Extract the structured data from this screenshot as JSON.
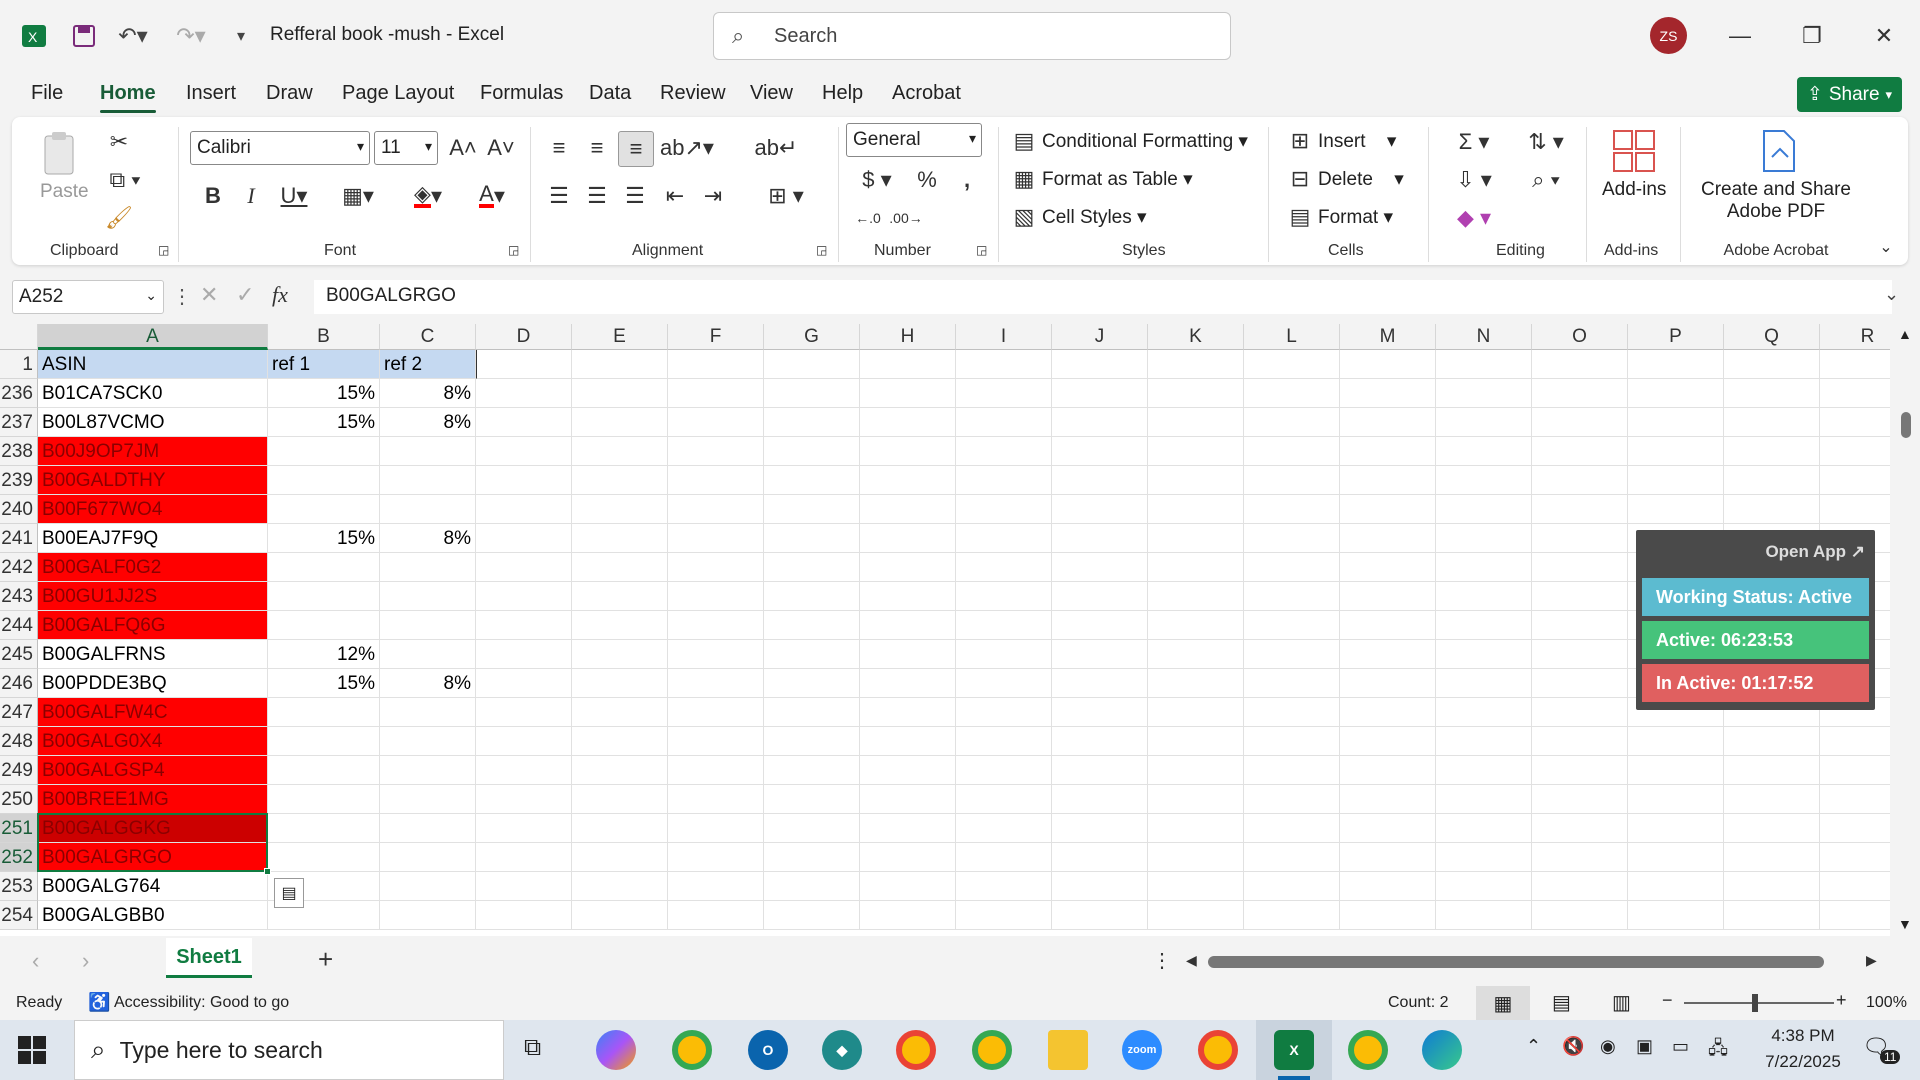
{
  "app": {
    "title": "Refferal book -mush  -  Excel",
    "avatar_initials": "ZS"
  },
  "search": {
    "placeholder": "Search"
  },
  "tabs": [
    "File",
    "Home",
    "Insert",
    "Draw",
    "Page Layout",
    "Formulas",
    "Data",
    "Review",
    "View",
    "Help",
    "Acrobat"
  ],
  "active_tab": "Home",
  "share_label": "Share",
  "ribbon": {
    "clipboard": {
      "label": "Clipboard",
      "paste": "Paste"
    },
    "font": {
      "label": "Font",
      "name": "Calibri",
      "size": "11"
    },
    "alignment": {
      "label": "Alignment"
    },
    "number": {
      "label": "Number",
      "format": "General"
    },
    "styles": {
      "label": "Styles",
      "conditional": "Conditional Formatting",
      "format_table": "Format as Table",
      "cell_styles": "Cell Styles"
    },
    "cells": {
      "label": "Cells",
      "insert": "Insert",
      "delete": "Delete",
      "format": "Format"
    },
    "editing": {
      "label": "Editing"
    },
    "addins": {
      "label": "Add-ins",
      "button": "Add-ins"
    },
    "acrobat": {
      "label": "Adobe Acrobat",
      "button_line1": "Create and Share",
      "button_line2": "Adobe PDF"
    }
  },
  "formula_bar": {
    "name_box": "A252",
    "fx": "fx",
    "value": "B00GALGRGO"
  },
  "columns": [
    "A",
    "B",
    "C",
    "D",
    "E",
    "F",
    "G",
    "H",
    "I",
    "J",
    "K",
    "L",
    "M",
    "N",
    "O",
    "P",
    "Q",
    "R"
  ],
  "rows": [
    {
      "num": "1",
      "a": "ASIN",
      "b": "ref 1",
      "c": "ref 2",
      "style": "header"
    },
    {
      "num": "236",
      "a": "B01CA7SCK0",
      "b": "15%",
      "c": "8%",
      "style": "normal"
    },
    {
      "num": "237",
      "a": "B00L87VCMO",
      "b": "15%",
      "c": "8%",
      "style": "normal"
    },
    {
      "num": "238",
      "a": "B00J9OP7JM",
      "b": "",
      "c": "",
      "style": "red"
    },
    {
      "num": "239",
      "a": "B00GALDTHY",
      "b": "",
      "c": "",
      "style": "red"
    },
    {
      "num": "240",
      "a": "B00F677WO4",
      "b": "",
      "c": "",
      "style": "red"
    },
    {
      "num": "241",
      "a": "B00EAJ7F9Q",
      "b": "15%",
      "c": "8%",
      "style": "normal"
    },
    {
      "num": "242",
      "a": "B00GALF0G2",
      "b": "",
      "c": "",
      "style": "red"
    },
    {
      "num": "243",
      "a": "B00GU1JJ2S",
      "b": "",
      "c": "",
      "style": "red"
    },
    {
      "num": "244",
      "a": "B00GALFQ6G",
      "b": "",
      "c": "",
      "style": "red"
    },
    {
      "num": "245",
      "a": "B00GALFRNS",
      "b": "12%",
      "c": "",
      "style": "normal"
    },
    {
      "num": "246",
      "a": "B00PDDE3BQ",
      "b": "15%",
      "c": "8%",
      "style": "normal"
    },
    {
      "num": "247",
      "a": "B00GALFW4C",
      "b": "",
      "c": "",
      "style": "red"
    },
    {
      "num": "248",
      "a": "B00GALG0X4",
      "b": "",
      "c": "",
      "style": "red"
    },
    {
      "num": "249",
      "a": "B00GALGSP4",
      "b": "",
      "c": "",
      "style": "red"
    },
    {
      "num": "250",
      "a": "B00BREE1MG",
      "b": "",
      "c": "",
      "style": "red"
    },
    {
      "num": "251",
      "a": "B00GALGGKG",
      "b": "",
      "c": "",
      "style": "red-selected"
    },
    {
      "num": "252",
      "a": "B00GALGRGO",
      "b": "",
      "c": "",
      "style": "red-active"
    },
    {
      "num": "253",
      "a": "B00GALG764",
      "b": "",
      "c": "",
      "style": "normal"
    },
    {
      "num": "254",
      "a": "B00GALGBB0",
      "b": "",
      "c": "",
      "style": "normal"
    }
  ],
  "sheet_tab": "Sheet1",
  "status": {
    "ready": "Ready",
    "accessibility": "Accessibility: Good to go",
    "count": "Count: 2",
    "zoom": "100%"
  },
  "widget": {
    "open_app": "Open App ↗",
    "working": "Working Status: Active",
    "active": "Active: 06:23:53",
    "inactive": "In Active: 01:17:52"
  },
  "taskbar": {
    "search_placeholder": "Type here to search",
    "time": "4:38 PM",
    "date": "7/22/2025",
    "notif_count": "11"
  },
  "colors": {
    "excel_green": "#107c41",
    "red_fill": "#ff0000",
    "selected_red": "#cc0000",
    "status_active": "#5cbbd0",
    "active_green": "#46c37b",
    "inactive_red": "#e06060"
  }
}
